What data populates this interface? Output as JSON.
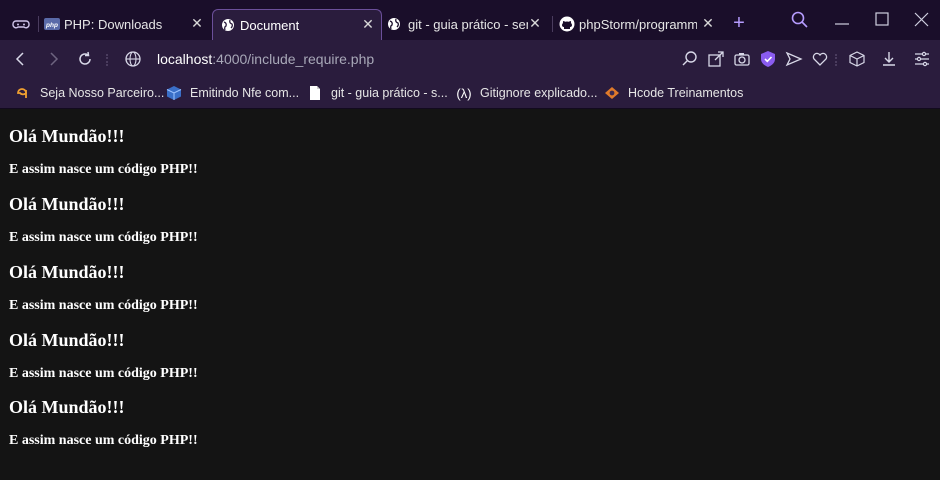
{
  "tabs": [
    {
      "label": "PHP: Downloads",
      "icon": "php-icon",
      "active": false
    },
    {
      "label": "Document",
      "icon": "globe-icon",
      "active": true
    },
    {
      "label": "git - guia prático - sem",
      "icon": "globe-icon",
      "active": false
    },
    {
      "label": "phpStorm/programme",
      "icon": "github-icon",
      "active": false
    }
  ],
  "address": {
    "host": "localhost",
    "path": ":4000/include_require.php"
  },
  "bookmarks": [
    {
      "label": "Seja Nosso Parceiro...",
      "icon": "partner-icon"
    },
    {
      "label": "Emitindo Nfe com...",
      "icon": "box-icon"
    },
    {
      "label": "git - guia prático - s...",
      "icon": "document-icon"
    },
    {
      "label": "Gitignore explicado...",
      "icon": "lambda-icon"
    },
    {
      "label": "Hcode Treinamentos",
      "icon": "hcode-icon"
    }
  ],
  "content": {
    "blocks": [
      {
        "heading": "Olá Mundão!!!",
        "text": "E assim nasce um código PHP!!"
      },
      {
        "heading": "Olá Mundão!!!",
        "text": "E assim nasce um código PHP!!"
      },
      {
        "heading": "Olá Mundão!!!",
        "text": "E assim nasce um código PHP!!"
      },
      {
        "heading": "Olá Mundão!!!",
        "text": "E assim nasce um código PHP!!"
      },
      {
        "heading": "Olá Mundão!!!",
        "text": "E assim nasce um código PHP!!"
      }
    ]
  },
  "colors": {
    "tabbar": "#1a0e2a",
    "toolbar": "#2a1c3d",
    "accent": "#b69cff",
    "page_bg": "#141414"
  }
}
